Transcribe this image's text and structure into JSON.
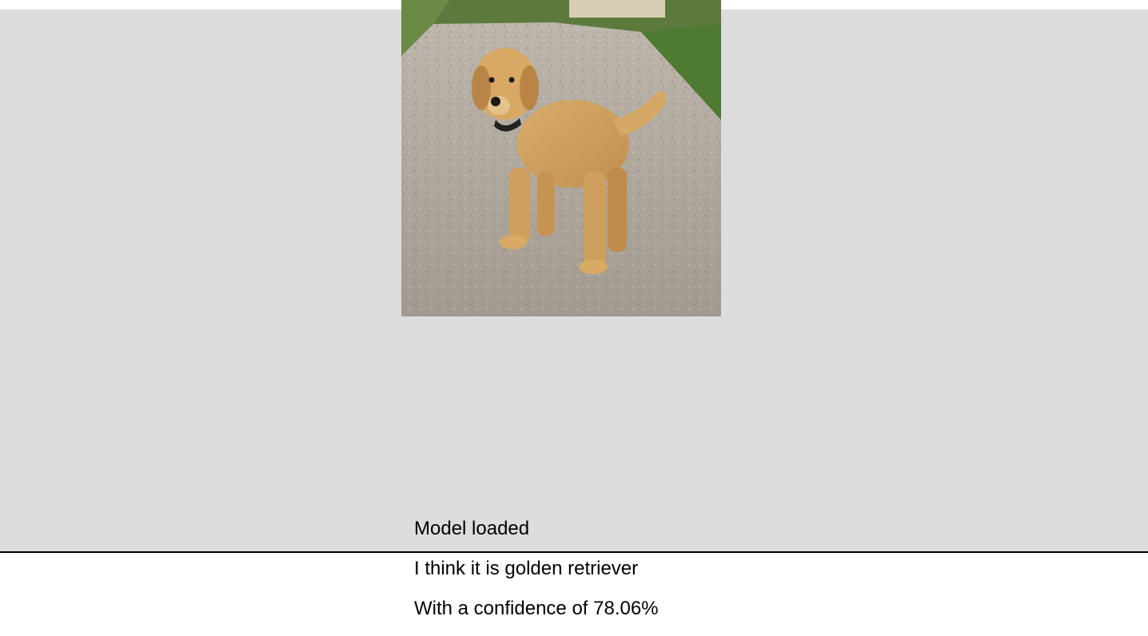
{
  "image": {
    "alt": "golden retriever puppy standing on a gravel road"
  },
  "status": {
    "model_state": "Model loaded",
    "prediction": "I think it is golden retriever",
    "confidence_prefix": "With a confidence of ",
    "confidence_value": "78.06%"
  }
}
